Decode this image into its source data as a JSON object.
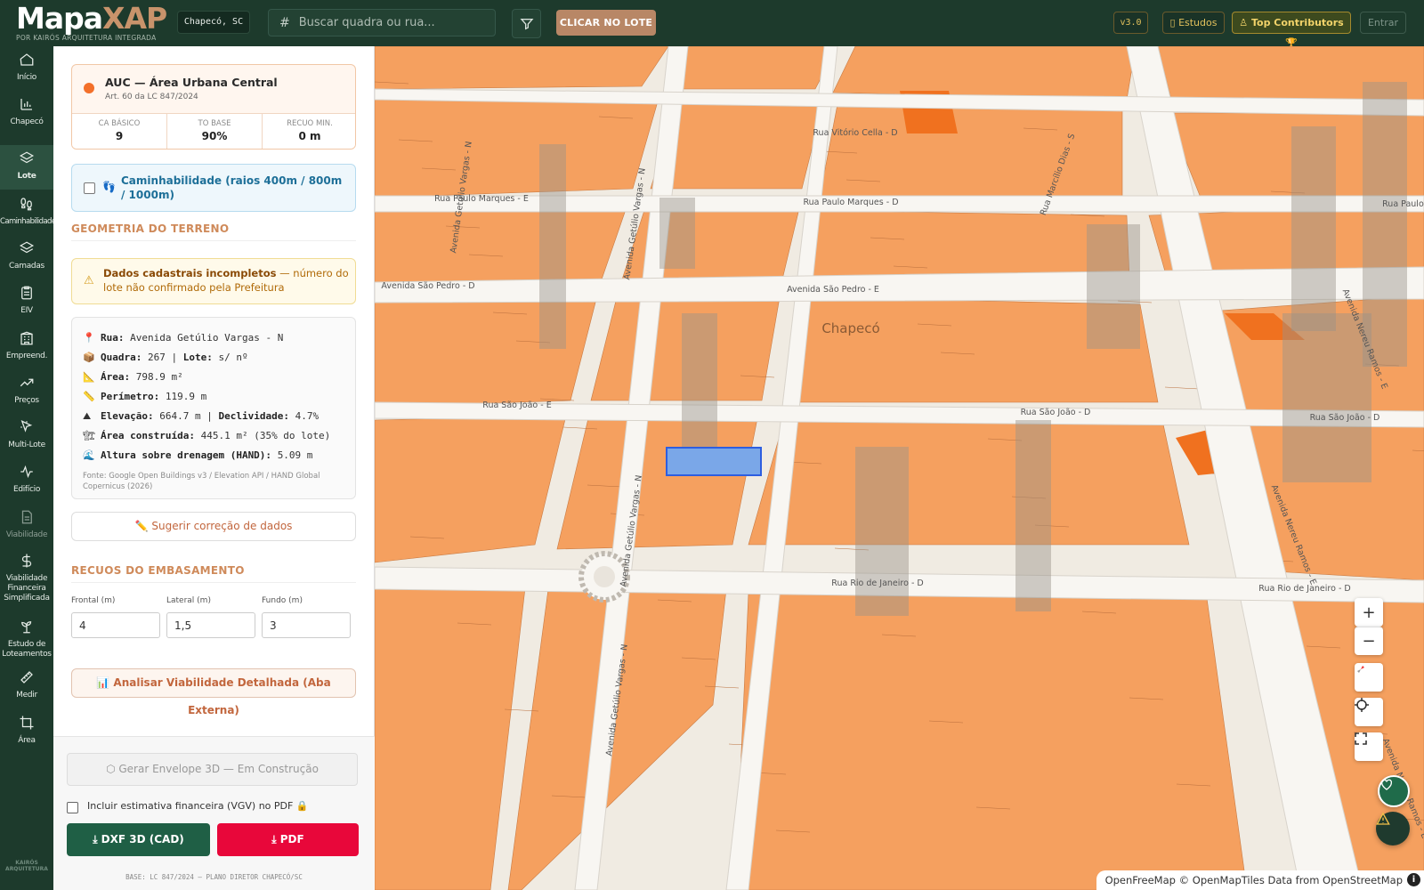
{
  "app": {
    "logo_main": "Mapa",
    "logo_accent": "XAP",
    "logo_sub": "POR KAIRÓS ARQUITETURA INTEGRADA",
    "city": "Chapecó, SC",
    "search_placeholder": "Buscar quadra ou rua...",
    "click_lote": "CLICAR NO LOTE",
    "version": "v3.0",
    "estudos": "Estudos",
    "top_contributors": "Top Contributors 🏆",
    "entrar": "Entrar"
  },
  "nav": {
    "items": [
      {
        "label": "Início",
        "icon": "home-icon"
      },
      {
        "label": "Chapecó",
        "icon": "bar-chart-icon"
      },
      {
        "label": "Lote",
        "icon": "layers-icon"
      },
      {
        "label": "Caminhabilidade",
        "icon": "footprints-icon"
      },
      {
        "label": "Camadas",
        "icon": "layers-icon"
      },
      {
        "label": "EIV",
        "icon": "clipboard-icon"
      },
      {
        "label": "Empreend.",
        "icon": "building-icon"
      },
      {
        "label": "Preços",
        "icon": "trend-icon"
      },
      {
        "label": "Multi-Lote",
        "icon": "pointer-icon"
      },
      {
        "label": "Edifício",
        "icon": "pulse-icon"
      },
      {
        "label": "Viabilidade",
        "icon": "document-lock-icon"
      },
      {
        "label": "Viabilidade Financeira Simplificada",
        "icon": "dollar-icon"
      },
      {
        "label": "Estudo de Loteamentos",
        "icon": "sprout-icon"
      },
      {
        "label": "Medir",
        "icon": "ruler-icon"
      },
      {
        "label": "Área",
        "icon": "crop-icon"
      }
    ],
    "footer": "KAIRÓS ARQUITETURA"
  },
  "zone": {
    "title": "AUC — Área Urbana Central",
    "law": "Art. 60 da LC 847/2024",
    "ca_label": "CA BÁSICO",
    "ca_value": "9",
    "to_label": "TO BASE",
    "to_value": "90%",
    "recuo_label": "RECUO MIN.",
    "recuo_value": "0 m"
  },
  "walk": {
    "label": "Caminhabilidade (raios 400m / 800m / 1000m)"
  },
  "geometry": {
    "section": "GEOMETRIA DO TERRENO",
    "warn_bold": "Dados cadastrais incompletos",
    "warn_rest": " — número do lote não confirmado pela Prefeitura",
    "rua_k": "Rua:",
    "rua_v": "Avenida Getúlio Vargas - N",
    "quadra_k": "Quadra:",
    "quadra_v": "267 |",
    "lote_k": "Lote:",
    "lote_v": "s/ nº",
    "area_k": "Área:",
    "area_v": "798.9 m²",
    "perim_k": "Perímetro:",
    "perim_v": "119.9 m",
    "elev_k": "Elevação:",
    "elev_v": "664.7 m |",
    "decl_k": "Declividade:",
    "decl_v": "4.7%",
    "constr_k": "Área construída:",
    "constr_v": "445.1 m² (35% do lote)",
    "hand_k": "Altura sobre drenagem (HAND):",
    "hand_v": "5.09 m",
    "source": "Fonte: Google Open Buildings v3 / Elevation API / HAND Global Copernicus (2026)",
    "suggest": "✏️ Sugerir correção de dados"
  },
  "recuos": {
    "section": "RECUOS DO EMBASAMENTO",
    "frontal_label": "Frontal (m)",
    "frontal_value": "4",
    "lateral_label": "Lateral (m)",
    "lateral_value": "1,5",
    "fundo_label": "Fundo (m)",
    "fundo_value": "3",
    "analyze": "📊 Analisar Viabilidade Detalhada (Aba Externa)"
  },
  "footer": {
    "envelope": "⬡ Gerar Envelope 3D — Em Construção",
    "vgv": "Incluir estimativa financeira (VGV) no PDF 🔒",
    "dxf": "⤓ DXF 3D (CAD)",
    "pdf": "⤓ PDF",
    "base": "BASE: LC 847/2024 — PLANO DIRETOR CHAPECÓ/SC"
  },
  "map": {
    "city_label": "Chapecó",
    "streets": [
      "Rua Vitório Cella - D",
      "Rua Paulo Marques - D",
      "Rua Paulo Marques - E",
      "Rua Paulo Marques - E",
      "Avenida São Pedro - D",
      "Avenida São Pedro - E",
      "Rua São João - D",
      "Rua São João - E",
      "Rua São João - D",
      "Rua Rio de Janeiro - D",
      "Rua Rio de Janeiro - D",
      "Avenida Getúlio Vargas - N",
      "Avenida Getúlio Vargas - N",
      "Avenida Getúlio Vargas - N",
      "Avenida Nereu Ramos - E",
      "Avenida Nereu Ramos - E",
      "Avenida Nereu Ramos - E",
      "Rua Marcílio Dias - S",
      "Avenida Getúlio Vargas - N"
    ],
    "attribution": "OpenFreeMap © OpenMapTiles Data from OpenStreetMap",
    "info": "i",
    "building_color": "#f5a05f",
    "selected_color": "#7aa7e8"
  }
}
